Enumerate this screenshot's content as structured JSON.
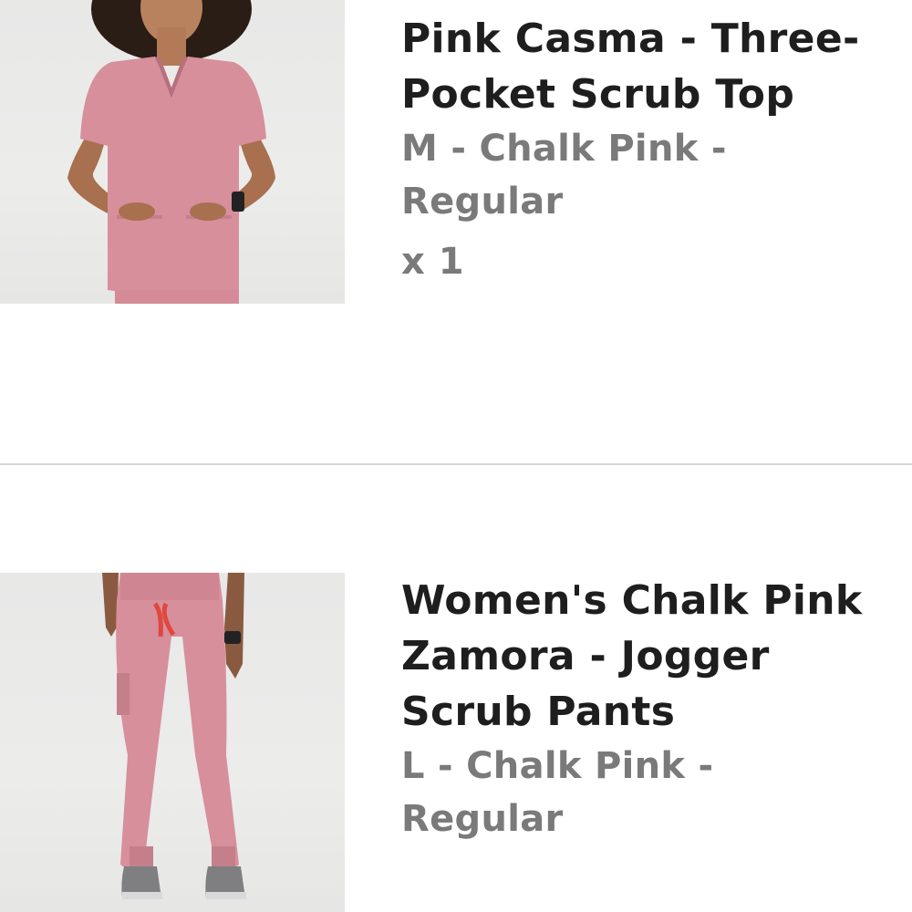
{
  "items": [
    {
      "title": "Pink Casma - Three-Pocket Scrub Top",
      "variant": "M - Chalk Pink - Regular",
      "quantity": "x 1",
      "image_alt": "scrub-top-photo"
    },
    {
      "title": "Women's Chalk Pink Zamora - Jogger Scrub Pants",
      "variant": "L - Chalk Pink - Regular",
      "image_alt": "jogger-pants-photo"
    }
  ],
  "colors": {
    "product_pink": "#d78f9b",
    "drawstring_red": "#e0473e",
    "title_text": "#1e1e1e",
    "meta_text": "#7a7a7a",
    "divider": "#d6d6d6"
  }
}
